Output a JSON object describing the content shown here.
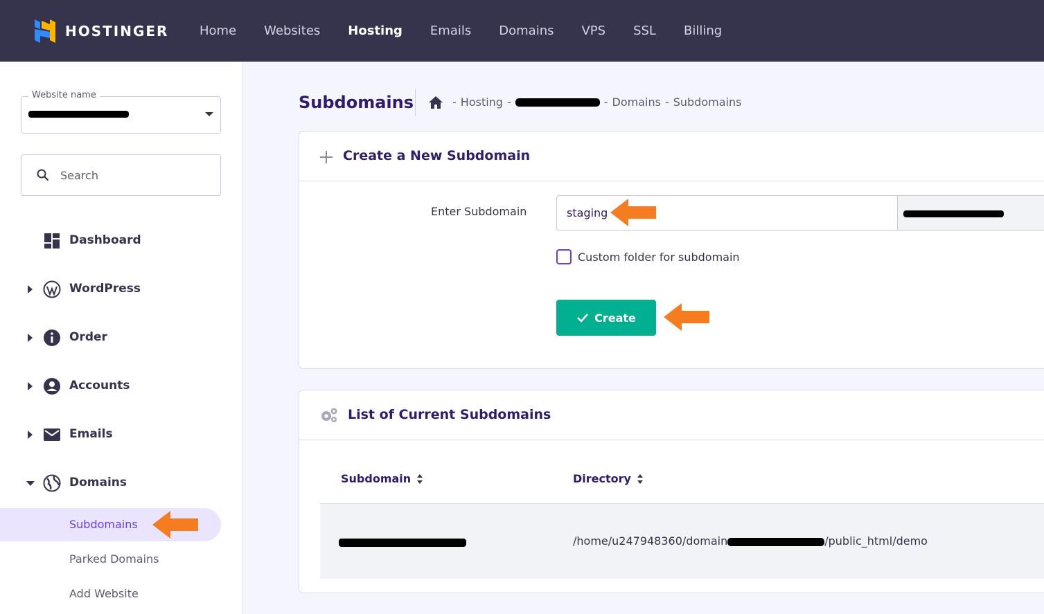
{
  "brand": {
    "name": "HOSTINGER"
  },
  "nav": {
    "items": [
      {
        "label": "Home",
        "active": false
      },
      {
        "label": "Websites",
        "active": false
      },
      {
        "label": "Hosting",
        "active": true
      },
      {
        "label": "Emails",
        "active": false
      },
      {
        "label": "Domains",
        "active": false
      },
      {
        "label": "VPS",
        "active": false
      },
      {
        "label": "SSL",
        "active": false
      },
      {
        "label": "Billing",
        "active": false
      }
    ]
  },
  "sidebar": {
    "website_select": {
      "legend": "Website name",
      "value": ""
    },
    "search": {
      "placeholder": "Search"
    },
    "menu": [
      {
        "label": "Dashboard",
        "icon": "dashboard-icon",
        "expandable": false
      },
      {
        "label": "WordPress",
        "icon": "wordpress-icon",
        "expandable": true
      },
      {
        "label": "Order",
        "icon": "info-icon",
        "expandable": true
      },
      {
        "label": "Accounts",
        "icon": "user-icon",
        "expandable": true
      },
      {
        "label": "Emails",
        "icon": "envelope-icon",
        "expandable": true
      },
      {
        "label": "Domains",
        "icon": "globe-icon",
        "expandable": true,
        "expanded": true
      }
    ],
    "domains_sub": [
      {
        "label": "Subdomains",
        "active": true
      },
      {
        "label": "Parked Domains",
        "active": false
      },
      {
        "label": "Add Website",
        "active": false
      }
    ]
  },
  "page": {
    "title": "Subdomains",
    "breadcrumb": [
      "Hosting",
      "Domains",
      "Subdomains"
    ]
  },
  "create_card": {
    "title": "Create a New Subdomain",
    "field_label": "Enter Subdomain",
    "subdomain_value": "staging",
    "custom_folder_label": "Custom folder for subdomain",
    "custom_folder_checked": false,
    "create_label": "Create"
  },
  "list_card": {
    "title": "List of Current Subdomains",
    "columns": [
      "Subdomain",
      "Directory"
    ],
    "rows": [
      {
        "directory_prefix": "/home/u247948360/domain",
        "directory_suffix": "/public_html/demo"
      }
    ]
  },
  "colors": {
    "topbar": "#36344d",
    "accent": "#673de6",
    "create_button": "#00b090",
    "annotation_arrow": "#f57c1f"
  }
}
